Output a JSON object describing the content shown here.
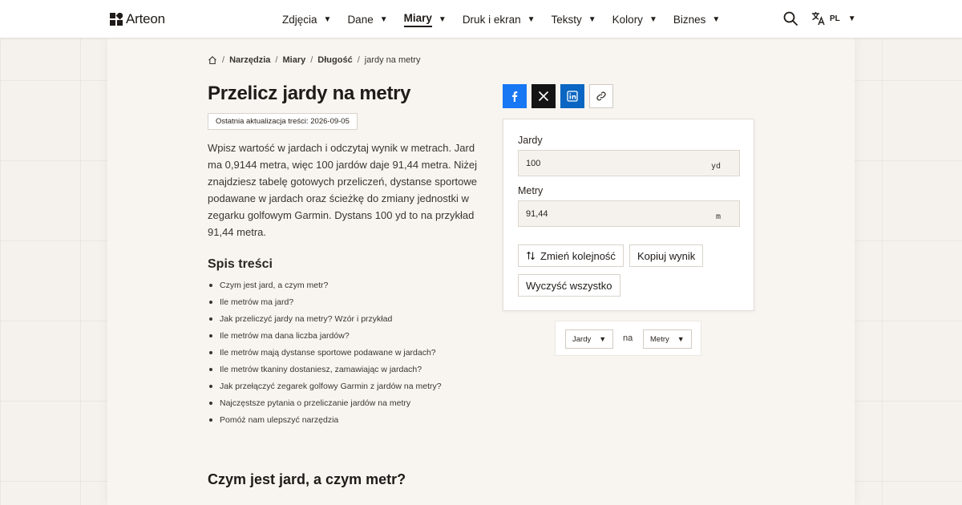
{
  "header": {
    "brand": "Arteon",
    "nav": [
      {
        "label": "Zdjęcia",
        "active": false
      },
      {
        "label": "Dane",
        "active": false
      },
      {
        "label": "Miary",
        "active": true
      },
      {
        "label": "Druk i ekran",
        "active": false
      },
      {
        "label": "Teksty",
        "active": false
      },
      {
        "label": "Kolory",
        "active": false
      },
      {
        "label": "Biznes",
        "active": false
      }
    ],
    "language": "PL"
  },
  "breadcrumb": {
    "items": [
      "Narzędzia",
      "Miary",
      "Długość"
    ],
    "current": "jardy na metry"
  },
  "page": {
    "title": "Przelicz jardy na metry",
    "updated": "Ostatnia aktualizacja treści: 2026-09-05",
    "intro": "Wpisz wartość w jardach i odczytaj wynik w metrach. Jard ma 0,9144 metra, więc 100 jardów daje 91,44 metra. Niżej znajdziesz tabelę gotowych przeliczeń, dystanse sportowe podawane w jardach oraz ścieżkę do zmiany jednostki w zegarku golfowym Garmin. Dystans 100 yd to na przykład 91,44 metra.",
    "toc_title": "Spis treści",
    "toc": [
      "Czym jest jard, a czym metr?",
      "Ile metrów ma jard?",
      "Jak przeliczyć jardy na metry? Wzór i przykład",
      "Ile metrów ma dana liczba jardów?",
      "Ile metrów mają dystanse sportowe podawane w jardach?",
      "Ile metrów tkaniny dostaniesz, zamawiając w jardach?",
      "Jak przełączyć zegarek golfowy Garmin z jardów na metry?",
      "Najczęstsze pytania o przeliczanie jardów na metry",
      "Pomóż nam ulepszyć narzędzia"
    ],
    "section_title": "Czym jest jard, a czym metr?"
  },
  "converter": {
    "from_label": "Jardy",
    "from_value": "100",
    "from_unit": "yd",
    "to_label": "Metry",
    "to_value": "91,44",
    "to_unit": "m",
    "swap_button": "Zmień kolejność",
    "copy_button": "Kopiuj wynik",
    "clear_button": "Wyczyść wszystko"
  },
  "unit_selector": {
    "from": "Jardy",
    "connector": "na",
    "to": "Metry"
  },
  "colors": {
    "facebook": "#1877f2",
    "x": "#141414",
    "linkedin": "#0a66c2",
    "background": "#f5f1ec"
  }
}
